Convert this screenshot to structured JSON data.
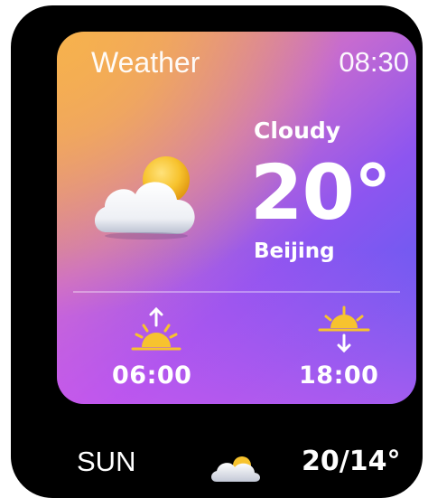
{
  "app": {
    "title": "Weather",
    "time": "08:30"
  },
  "current": {
    "condition": "Cloudy",
    "temperature": "20°",
    "city": "Beijing",
    "icon": "partly-cloudy-icon"
  },
  "sun": {
    "sunrise_time": "06:00",
    "sunset_time": "18:00",
    "sunrise_icon": "sunrise-icon",
    "sunset_icon": "sunset-icon"
  },
  "forecast": {
    "day": "SUN",
    "icon": "partly-cloudy-icon",
    "temp_range": "20/14°"
  },
  "colors": {
    "card_gradient": [
      "#f6b24d",
      "#c66bd0",
      "#4f61f3",
      "#e758ec"
    ],
    "sun_yellow": "#f7c32e",
    "background": "#000000",
    "text": "#ffffff"
  }
}
